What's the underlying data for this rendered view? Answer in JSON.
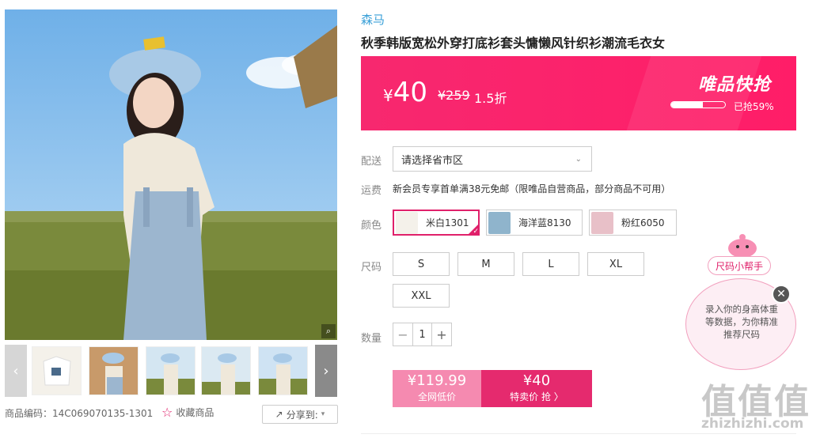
{
  "gallery": {
    "zoom_icon": "search-icon",
    "prev_icon": "chevron-left-icon",
    "next_icon": "chevron-right-icon",
    "product_code": "商品编码：14C069070135-1301",
    "favorite_label": "收藏商品",
    "share_label": "分享到:"
  },
  "product": {
    "brand": "森马",
    "title": "秋季韩版宽松外穿打底衫套头慵懒风针织衫潮流毛衣女"
  },
  "price_bar": {
    "yen": "¥",
    "price": "40",
    "original_price": "¥259",
    "discount": "1.5折",
    "flash_sale": "唯品快抢",
    "sold_percent": 59,
    "sold_text": "已抢59%",
    "color": "#f7286f"
  },
  "options": {
    "delivery_label": "配送",
    "delivery_value": "请选择省市区",
    "shipping_label": "运费",
    "shipping_text": "新会员专享首单满38元免邮（限唯品自营商品，部分商品不可用）",
    "color_label": "颜色",
    "colors": [
      {
        "name": "米白1301",
        "selected": true
      },
      {
        "name": "海洋蓝8130",
        "selected": false
      },
      {
        "name": "粉红6050",
        "selected": false
      }
    ],
    "size_label": "尺码",
    "sizes": [
      "S",
      "M",
      "L",
      "XL",
      "XXL"
    ],
    "qty_label": "数量",
    "qty": "1"
  },
  "buy": {
    "all_price": "¥119.99",
    "all_label": "全网低价",
    "sale_price": "¥40",
    "sale_label": "特卖价 抢 〉",
    "accent": "#e52a6e"
  },
  "size_helper": {
    "title": "尺码小帮手",
    "text": "录入你的身高体重等数据，为你精准推荐尺码",
    "close_icon": "close-icon"
  },
  "watermark": {
    "text": "值值值",
    "url": "zhizhizhi.com"
  }
}
